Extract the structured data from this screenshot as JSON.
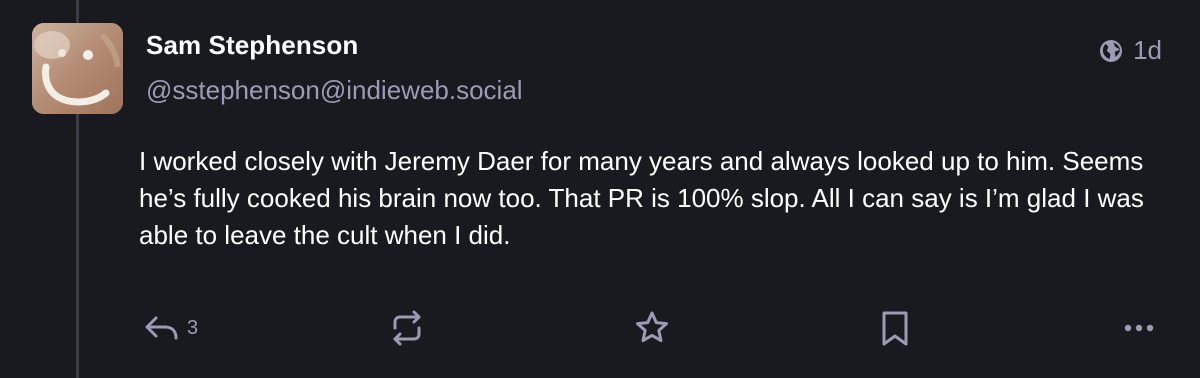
{
  "post": {
    "author": {
      "display_name": "Sam Stephenson",
      "handle": "@sstephenson@indieweb.social"
    },
    "visibility_icon": "globe-icon",
    "relative_time": "1d",
    "content": "I worked closely with Jeremy Daer for many years and always looked up to him. Seems he’s fully cooked his brain now too. That PR is 100% slop. All I can say is I’m glad I was able to leave the cult when I did.",
    "actions": {
      "reply_count": "3",
      "icons": [
        "reply-icon",
        "boost-icon",
        "star-icon",
        "bookmark-icon",
        "more-icon"
      ]
    }
  },
  "colors": {
    "background": "#191a20",
    "text_primary": "#ffffff",
    "text_secondary": "#9a9cb4",
    "thread_line": "#3b3c48"
  }
}
